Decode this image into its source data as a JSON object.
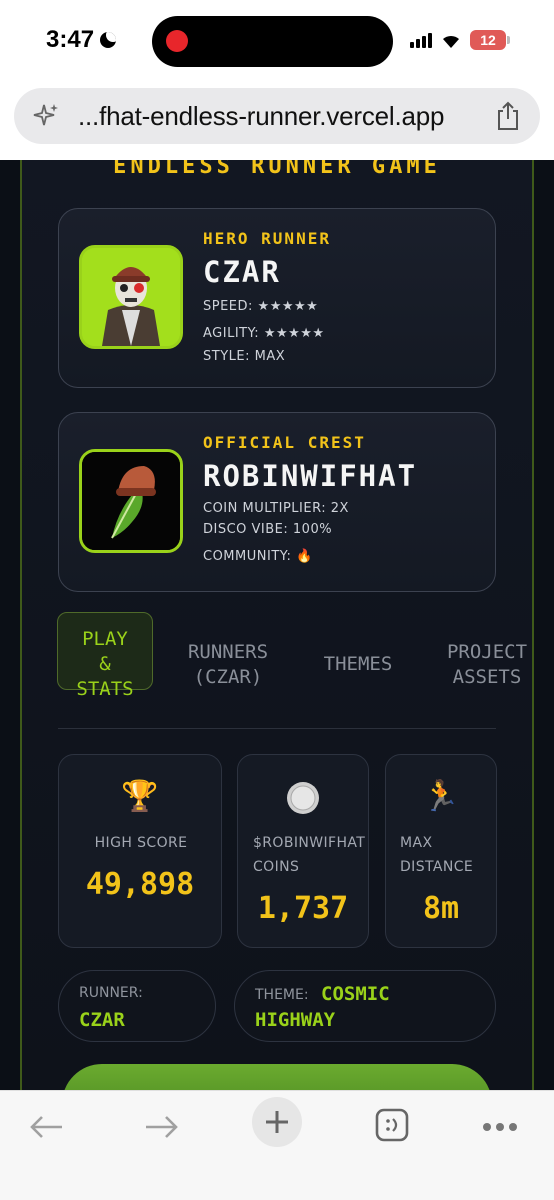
{
  "status_bar": {
    "time": "3:47",
    "battery": "12"
  },
  "browser": {
    "url": "...fhat-endless-runner.vercel.app"
  },
  "page": {
    "subtitle": "ENDLESS RUNNER GAME",
    "hero_card": {
      "label": "HERO RUNNER",
      "name": "CZAR",
      "lines": [
        "SPEED: ★★★★★",
        "AGILITY: ★★★★★",
        "STYLE: MAX"
      ]
    },
    "crest_card": {
      "label": "OFFICIAL CREST",
      "name": "ROBINWIFHAT",
      "lines": [
        "COIN MULTIPLIER: 2X",
        "DISCO VIBE: 100%",
        "COMMUNITY: 🔥"
      ]
    },
    "tabs": [
      {
        "label_lines": [
          "PLAY",
          "&",
          "STATS"
        ],
        "active": true
      },
      {
        "label_lines": [
          "RUNNERS",
          "(CZAR)"
        ],
        "active": false
      },
      {
        "label_lines": [
          "THEMES"
        ],
        "active": false
      },
      {
        "label_lines": [
          "PROJECT",
          "ASSETS"
        ],
        "active": false
      }
    ],
    "stats": [
      {
        "icon": "trophy-icon",
        "glyph": "🏆",
        "label_lines": [
          "HIGH SCORE"
        ],
        "value": "49,898"
      },
      {
        "icon": "coin-icon",
        "glyph": "",
        "label_lines": [
          "$ROBINWIFHAT",
          "COINS"
        ],
        "value": "1,737"
      },
      {
        "icon": "runner-icon",
        "glyph": "🏃",
        "label_lines": [
          "MAX",
          "DISTANCE"
        ],
        "value": "8m"
      }
    ],
    "runner_pill": {
      "label": "RUNNER:",
      "value": "CZAR"
    },
    "theme_pill": {
      "label": "THEME:",
      "value_lines": [
        "COSMIC",
        "HIGHWAY"
      ]
    }
  },
  "colors": {
    "accent_yellow": "#f2c31a",
    "accent_green": "#9ad21a",
    "background": "#0b0f16"
  }
}
